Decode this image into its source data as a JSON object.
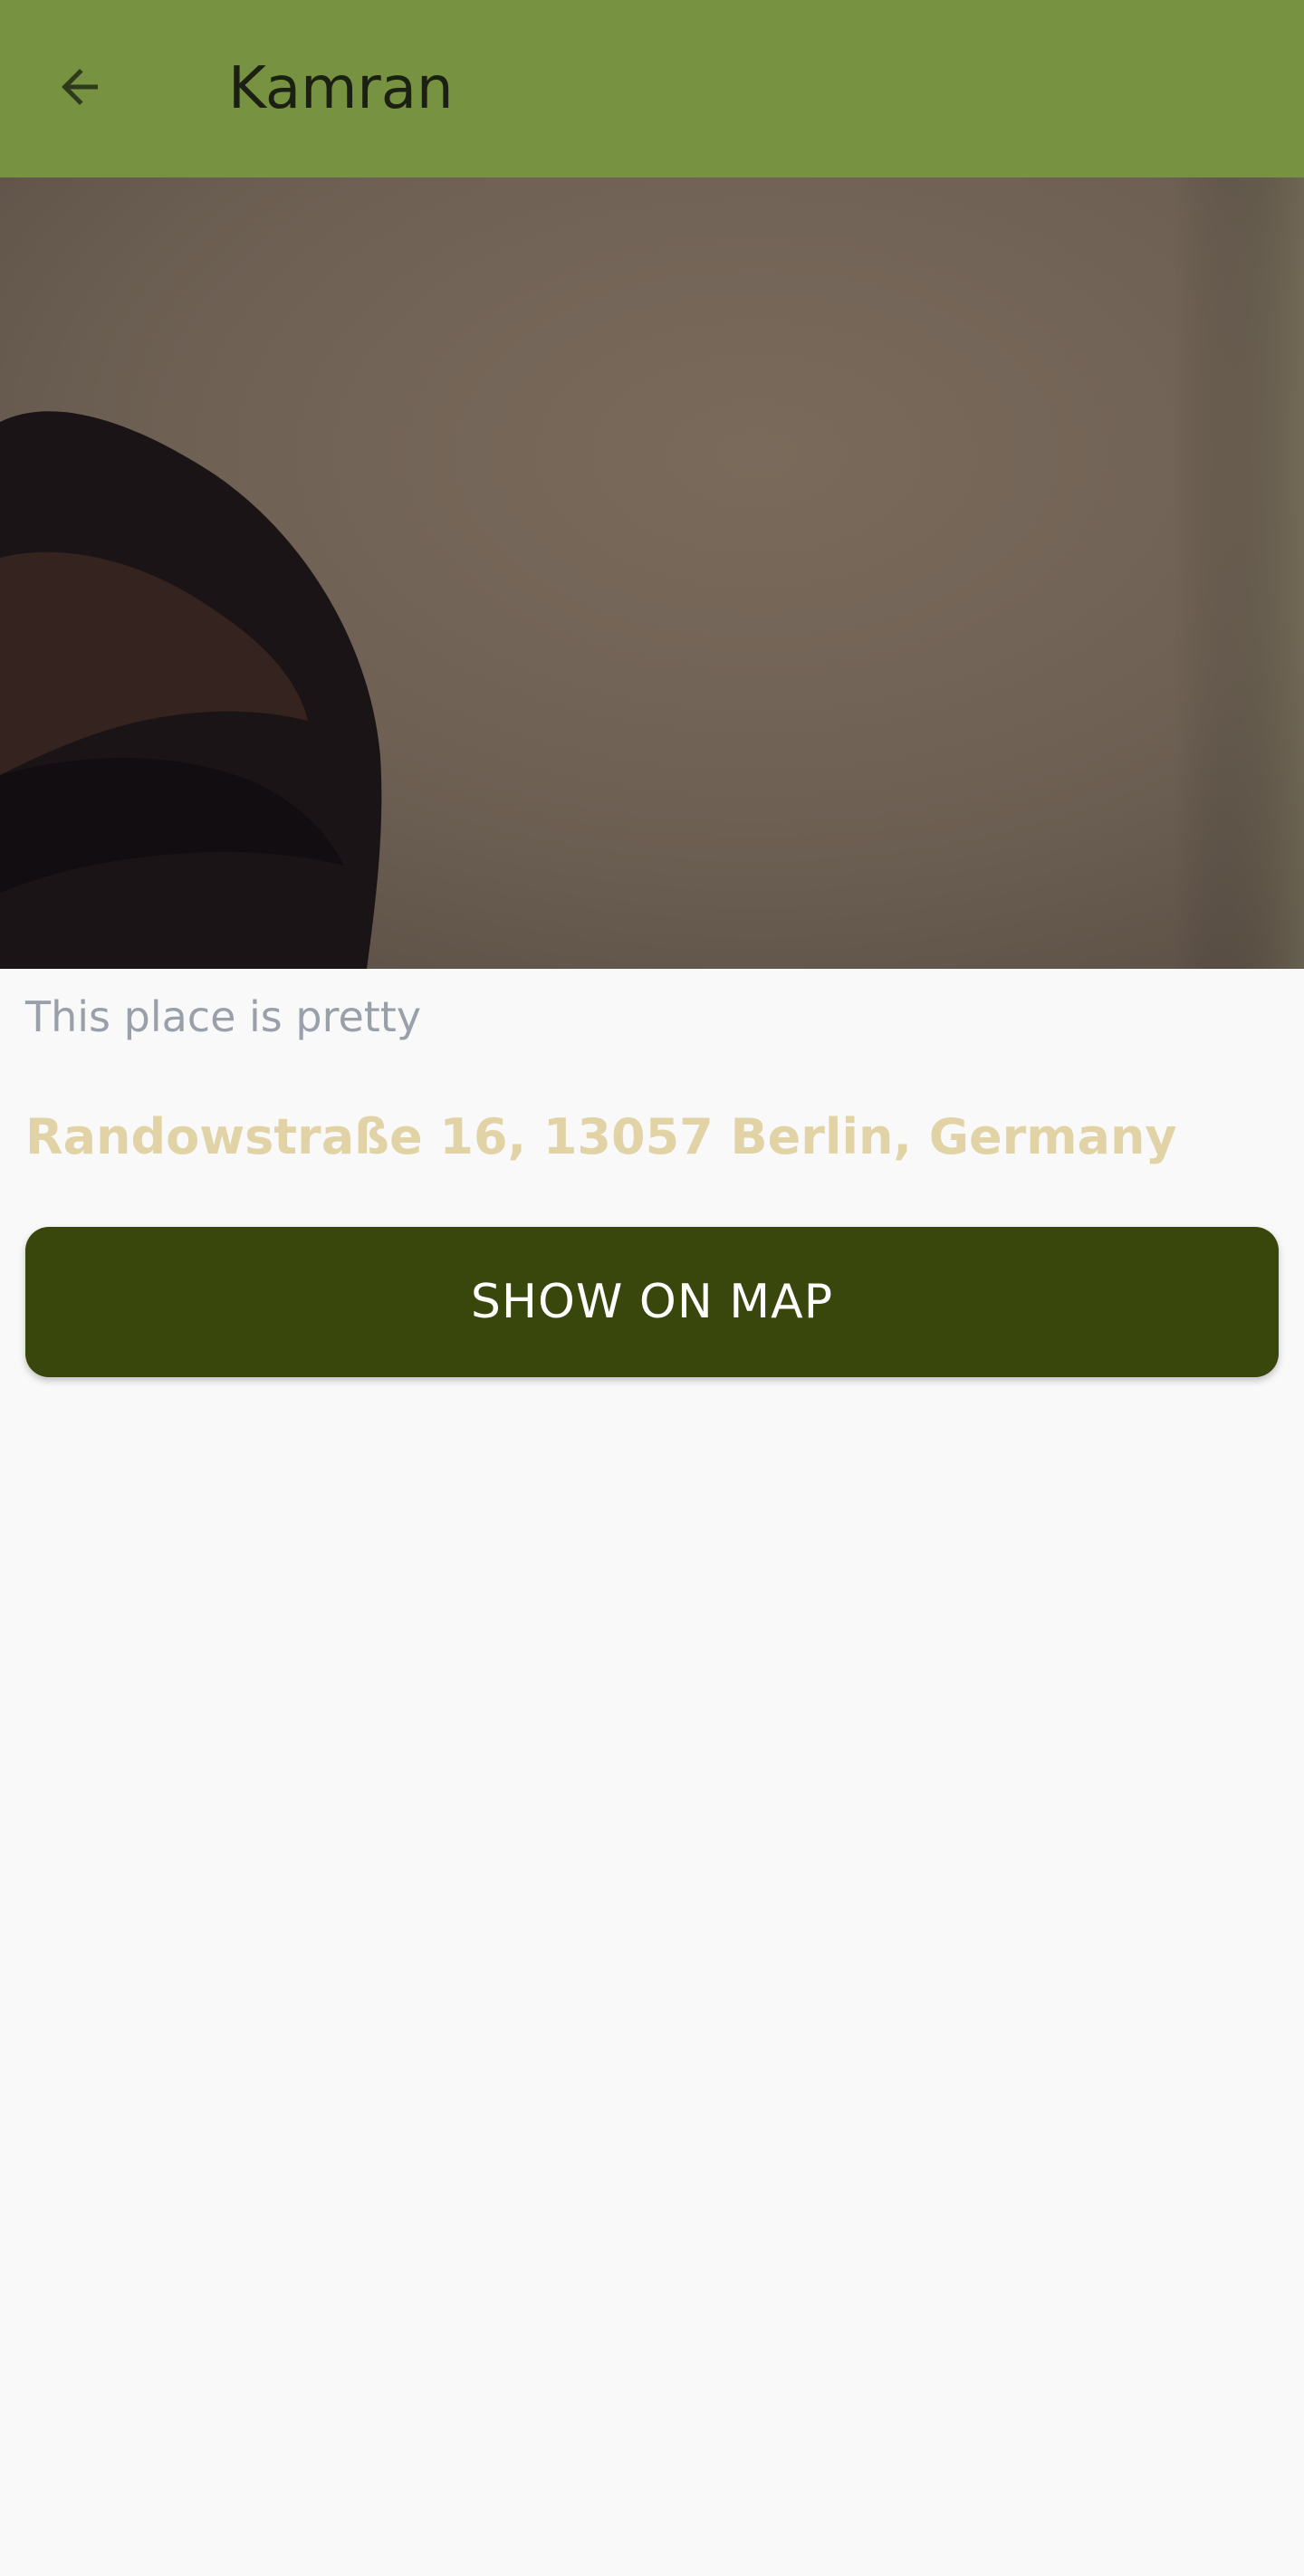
{
  "app_bar": {
    "title": "Kamran",
    "back_icon": "arrow-left-icon",
    "color": "#779240"
  },
  "place": {
    "photo_alt": "",
    "description": "This place is pretty",
    "address": "Randowstraße 16, 13057 Berlin, Germany",
    "address_color": "#e1d3a5"
  },
  "actions": {
    "show_on_map_label": "SHOW ON MAP",
    "button_color": "#39470d"
  }
}
